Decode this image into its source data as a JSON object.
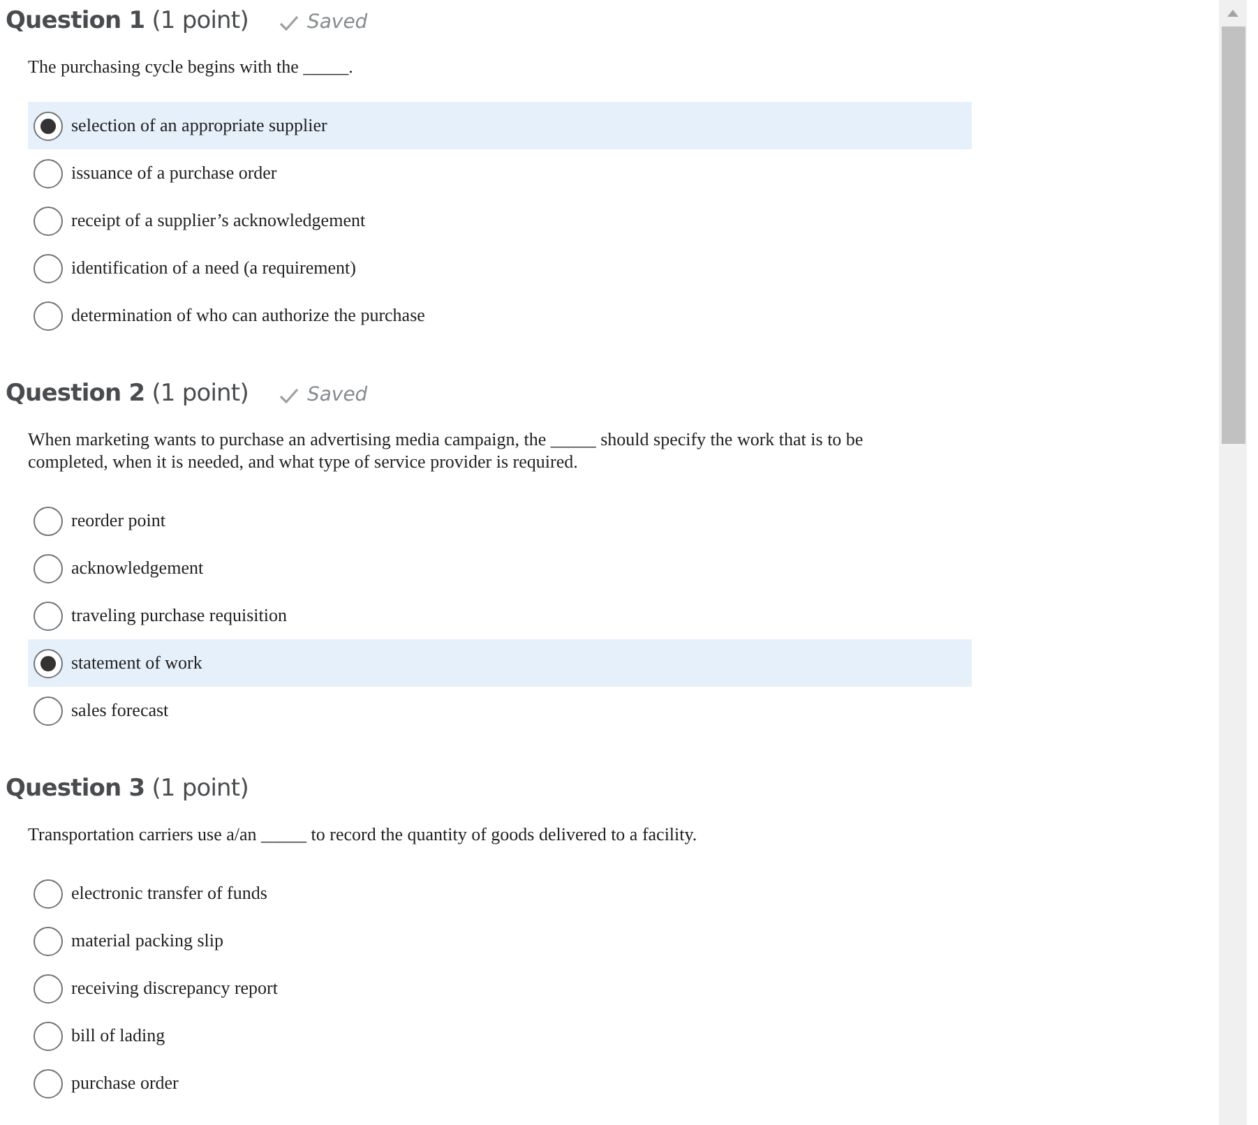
{
  "questions": [
    {
      "title": "Question 1",
      "points": "(1 point)",
      "status": "Saved",
      "prompt": "The purchasing cycle begins with the _____.",
      "options": [
        {
          "label": "selection of an appropriate supplier",
          "selected": true
        },
        {
          "label": "issuance of a purchase order",
          "selected": false
        },
        {
          "label": "receipt of a supplier’s acknowledgement",
          "selected": false
        },
        {
          "label": "identification of a need (a requirement)",
          "selected": false
        },
        {
          "label": "determination of who can authorize the purchase",
          "selected": false
        }
      ]
    },
    {
      "title": "Question 2",
      "points": "(1 point)",
      "status": "Saved",
      "prompt": "When marketing wants to purchase an advertising media campaign, the _____ should specify the work that is to be completed, when it is needed, and what type of service provider is required.",
      "options": [
        {
          "label": "reorder point",
          "selected": false
        },
        {
          "label": "acknowledgement",
          "selected": false
        },
        {
          "label": "traveling purchase requisition",
          "selected": false
        },
        {
          "label": "statement of work",
          "selected": true
        },
        {
          "label": "sales forecast",
          "selected": false
        }
      ]
    },
    {
      "title": "Question 3",
      "points": "(1 point)",
      "prompt": "Transportation carriers use a/an _____ to record the quantity of goods delivered to a facility.",
      "options": [
        {
          "label": "electronic transfer of funds",
          "selected": false
        },
        {
          "label": "material packing slip",
          "selected": false
        },
        {
          "label": "receiving discrepancy report",
          "selected": false
        },
        {
          "label": "bill of lading",
          "selected": false
        },
        {
          "label": "purchase order",
          "selected": false
        }
      ]
    }
  ]
}
